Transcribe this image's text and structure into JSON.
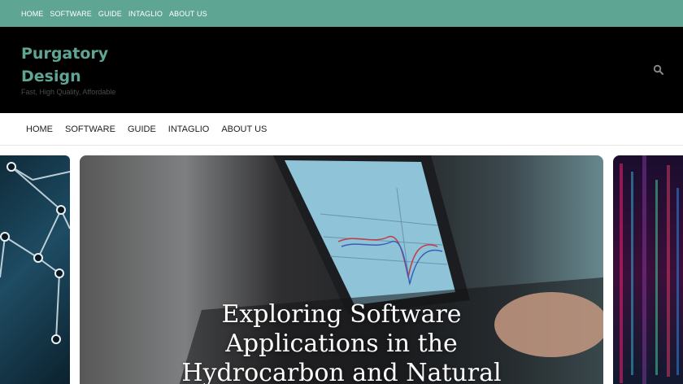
{
  "topbar": {
    "items": [
      "HOME",
      "SOFTWARE",
      "GUIDE",
      "INTAGLIO",
      "ABOUT US"
    ]
  },
  "header": {
    "site_title": "Purgatory Design",
    "tagline": "Fast, High Quality, Affordable",
    "search_icon": "search-icon"
  },
  "mainnav": {
    "items": [
      "HOME",
      "SOFTWARE",
      "GUIDE",
      "INTAGLIO",
      "ABOUT US"
    ]
  },
  "slider": {
    "featured_title": "Exploring Software Applications in the Hydrocarbon and Natural"
  },
  "colors": {
    "accent": "#5fa593",
    "header_bg": "#000000"
  }
}
